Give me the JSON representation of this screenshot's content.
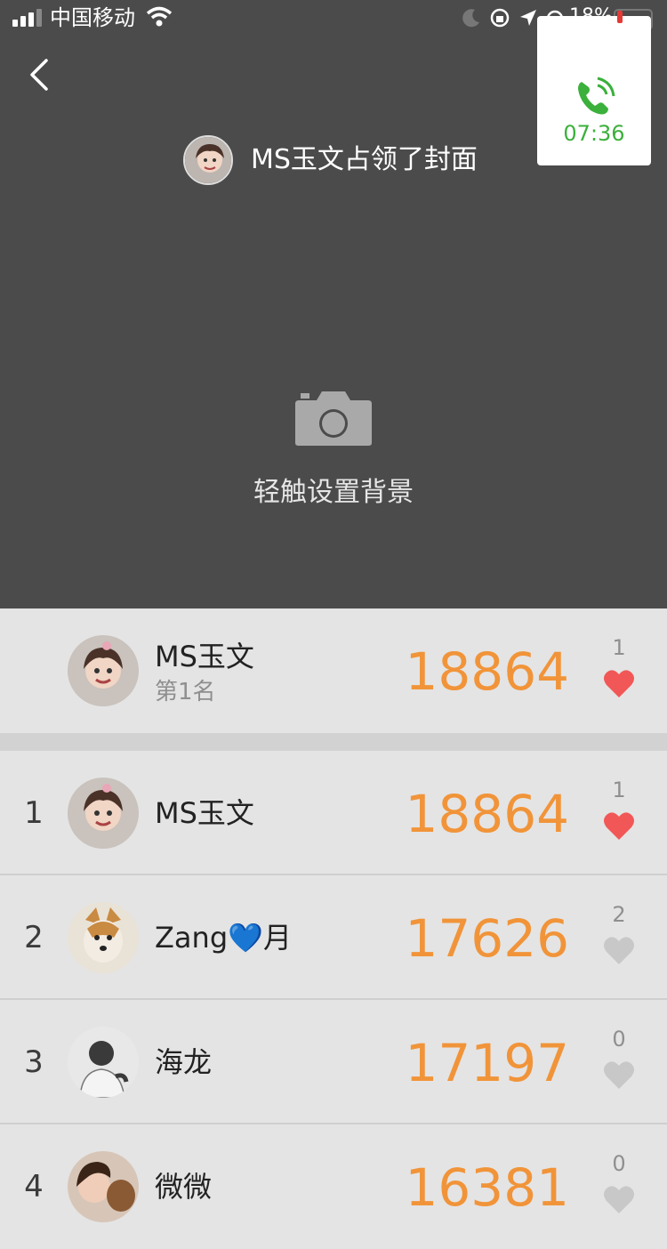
{
  "status_bar": {
    "carrier": "中国移动",
    "battery_pct": "18%"
  },
  "call_card": {
    "time": "07:36"
  },
  "cover": {
    "owner_text": "MS玉文占领了封面",
    "hint": "轻触设置背景"
  },
  "my_rank": {
    "name": "MS玉文",
    "position": "第1名",
    "steps": "18864",
    "likes": "1",
    "liked": true
  },
  "leaderboard": [
    {
      "rank": "1",
      "name": "MS玉文",
      "steps": "18864",
      "likes": "1",
      "liked": true
    },
    {
      "rank": "2",
      "name": "Zang💙月",
      "steps": "17626",
      "likes": "2",
      "liked": false
    },
    {
      "rank": "3",
      "name": "海龙",
      "steps": "17197",
      "likes": "0",
      "liked": false
    },
    {
      "rank": "4",
      "name": "微微",
      "steps": "16381",
      "likes": "0",
      "liked": false
    }
  ],
  "colors": {
    "header_bg": "#4b4b4b",
    "steps": "#f19439",
    "heart_active": "#f25757",
    "heart_inactive": "#c8c8c8",
    "call_green": "#3bb03b"
  },
  "icons": [
    "back-chevron-icon",
    "camera-icon",
    "phone-icon",
    "heart-icon",
    "wifi-icon",
    "signal-icon"
  ]
}
